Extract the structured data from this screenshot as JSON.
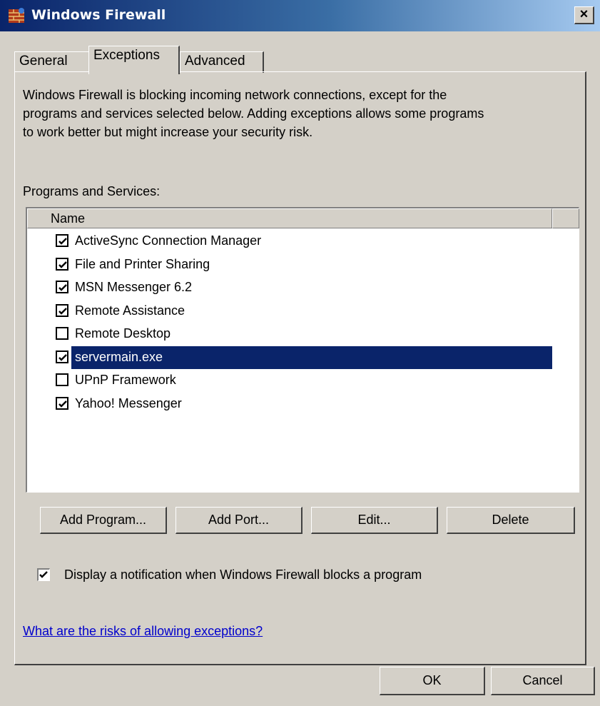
{
  "window": {
    "title": "Windows Firewall",
    "close_symbol": "×"
  },
  "tabs": [
    {
      "label": "General",
      "active": false
    },
    {
      "label": "Exceptions",
      "active": true
    },
    {
      "label": "Advanced",
      "active": false
    }
  ],
  "description": "Windows Firewall is blocking incoming network connections, except for the\nprograms and services selected below. Adding exceptions allows some programs\nto work better but might increase your security risk.",
  "programs_label": "Programs and Services:",
  "list": {
    "column_name": "Name",
    "items": [
      {
        "label": "ActiveSync Connection Manager",
        "checked": true,
        "selected": false
      },
      {
        "label": "File and Printer Sharing",
        "checked": true,
        "selected": false
      },
      {
        "label": "MSN Messenger 6.2",
        "checked": true,
        "selected": false
      },
      {
        "label": "Remote Assistance",
        "checked": true,
        "selected": false
      },
      {
        "label": "Remote Desktop",
        "checked": false,
        "selected": false
      },
      {
        "label": "servermain.exe",
        "checked": true,
        "selected": true
      },
      {
        "label": "UPnP Framework",
        "checked": false,
        "selected": false
      },
      {
        "label": "Yahoo! Messenger",
        "checked": true,
        "selected": false
      }
    ]
  },
  "buttons": {
    "add_program": "Add Program...",
    "add_port": "Add Port...",
    "edit": "Edit...",
    "delete": "Delete",
    "ok": "OK",
    "cancel": "Cancel"
  },
  "notification": {
    "label": "Display a notification when Windows Firewall blocks a program",
    "checked": true
  },
  "link_text": "What are the risks of allowing exceptions?",
  "colors": {
    "dialog_bg": "#d4d0c8",
    "selection": "#0a246a",
    "link": "#0000cc"
  }
}
